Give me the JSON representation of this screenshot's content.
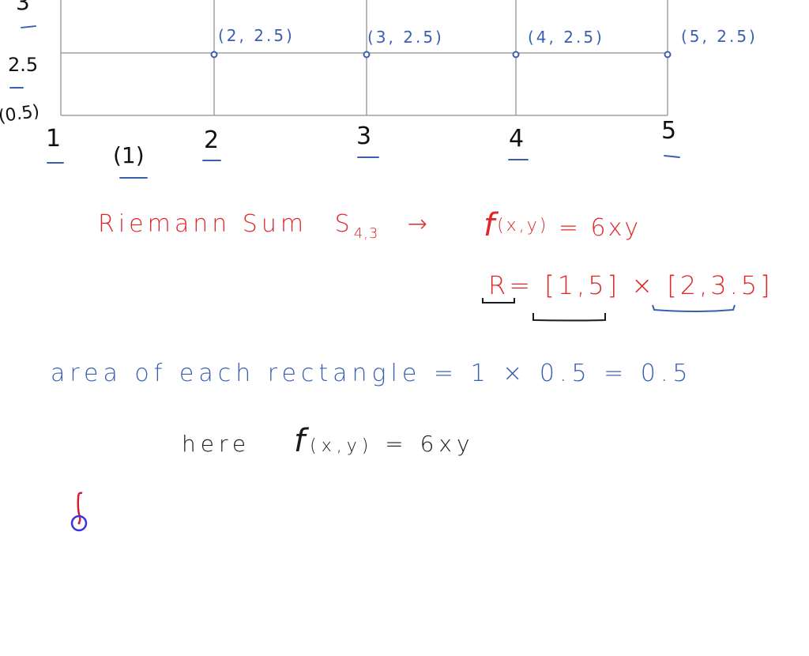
{
  "colors": {
    "blue_ink": "#3a5fb0",
    "red_ink": "#e0252b",
    "black_ink": "#1a1a1a",
    "grid": "#a0a0a0",
    "cursor_ring": "#4030e0"
  },
  "grid": {
    "x_ticks": [
      "1",
      "2",
      "3",
      "4",
      "5"
    ],
    "y_labels": [
      "3",
      "2.5",
      "(0.5)"
    ],
    "dx_label": "(1)",
    "points": [
      {
        "x": 2,
        "y": 2.5,
        "label": "(2, 2.5)"
      },
      {
        "x": 3,
        "y": 2.5,
        "label": "(3, 2.5)"
      },
      {
        "x": 4,
        "y": 2.5,
        "label": "(4, 2.5)"
      },
      {
        "x": 5,
        "y": 2.5,
        "label": "(5, 2.5)"
      }
    ]
  },
  "notes": {
    "riemann_text": "Riemann Sum",
    "riemann_S": "S",
    "riemann_sub": "4,3",
    "arrow": "→",
    "f_name": "f",
    "f_args": "(x,y)",
    "f_rhs": "= 6xy",
    "R_label": "R",
    "R_eq": "=",
    "R_int1": "[1,5]",
    "R_times": "×",
    "R_int2": "[2,3.5]",
    "area_text": "area of each rectangle = 1 × 0.5 = 0.5",
    "here_text": "here",
    "here_f": "f",
    "here_args": "(x,y)",
    "here_rhs": "= 6xy"
  },
  "cursor": {
    "icon": "pen-cursor-icon"
  }
}
